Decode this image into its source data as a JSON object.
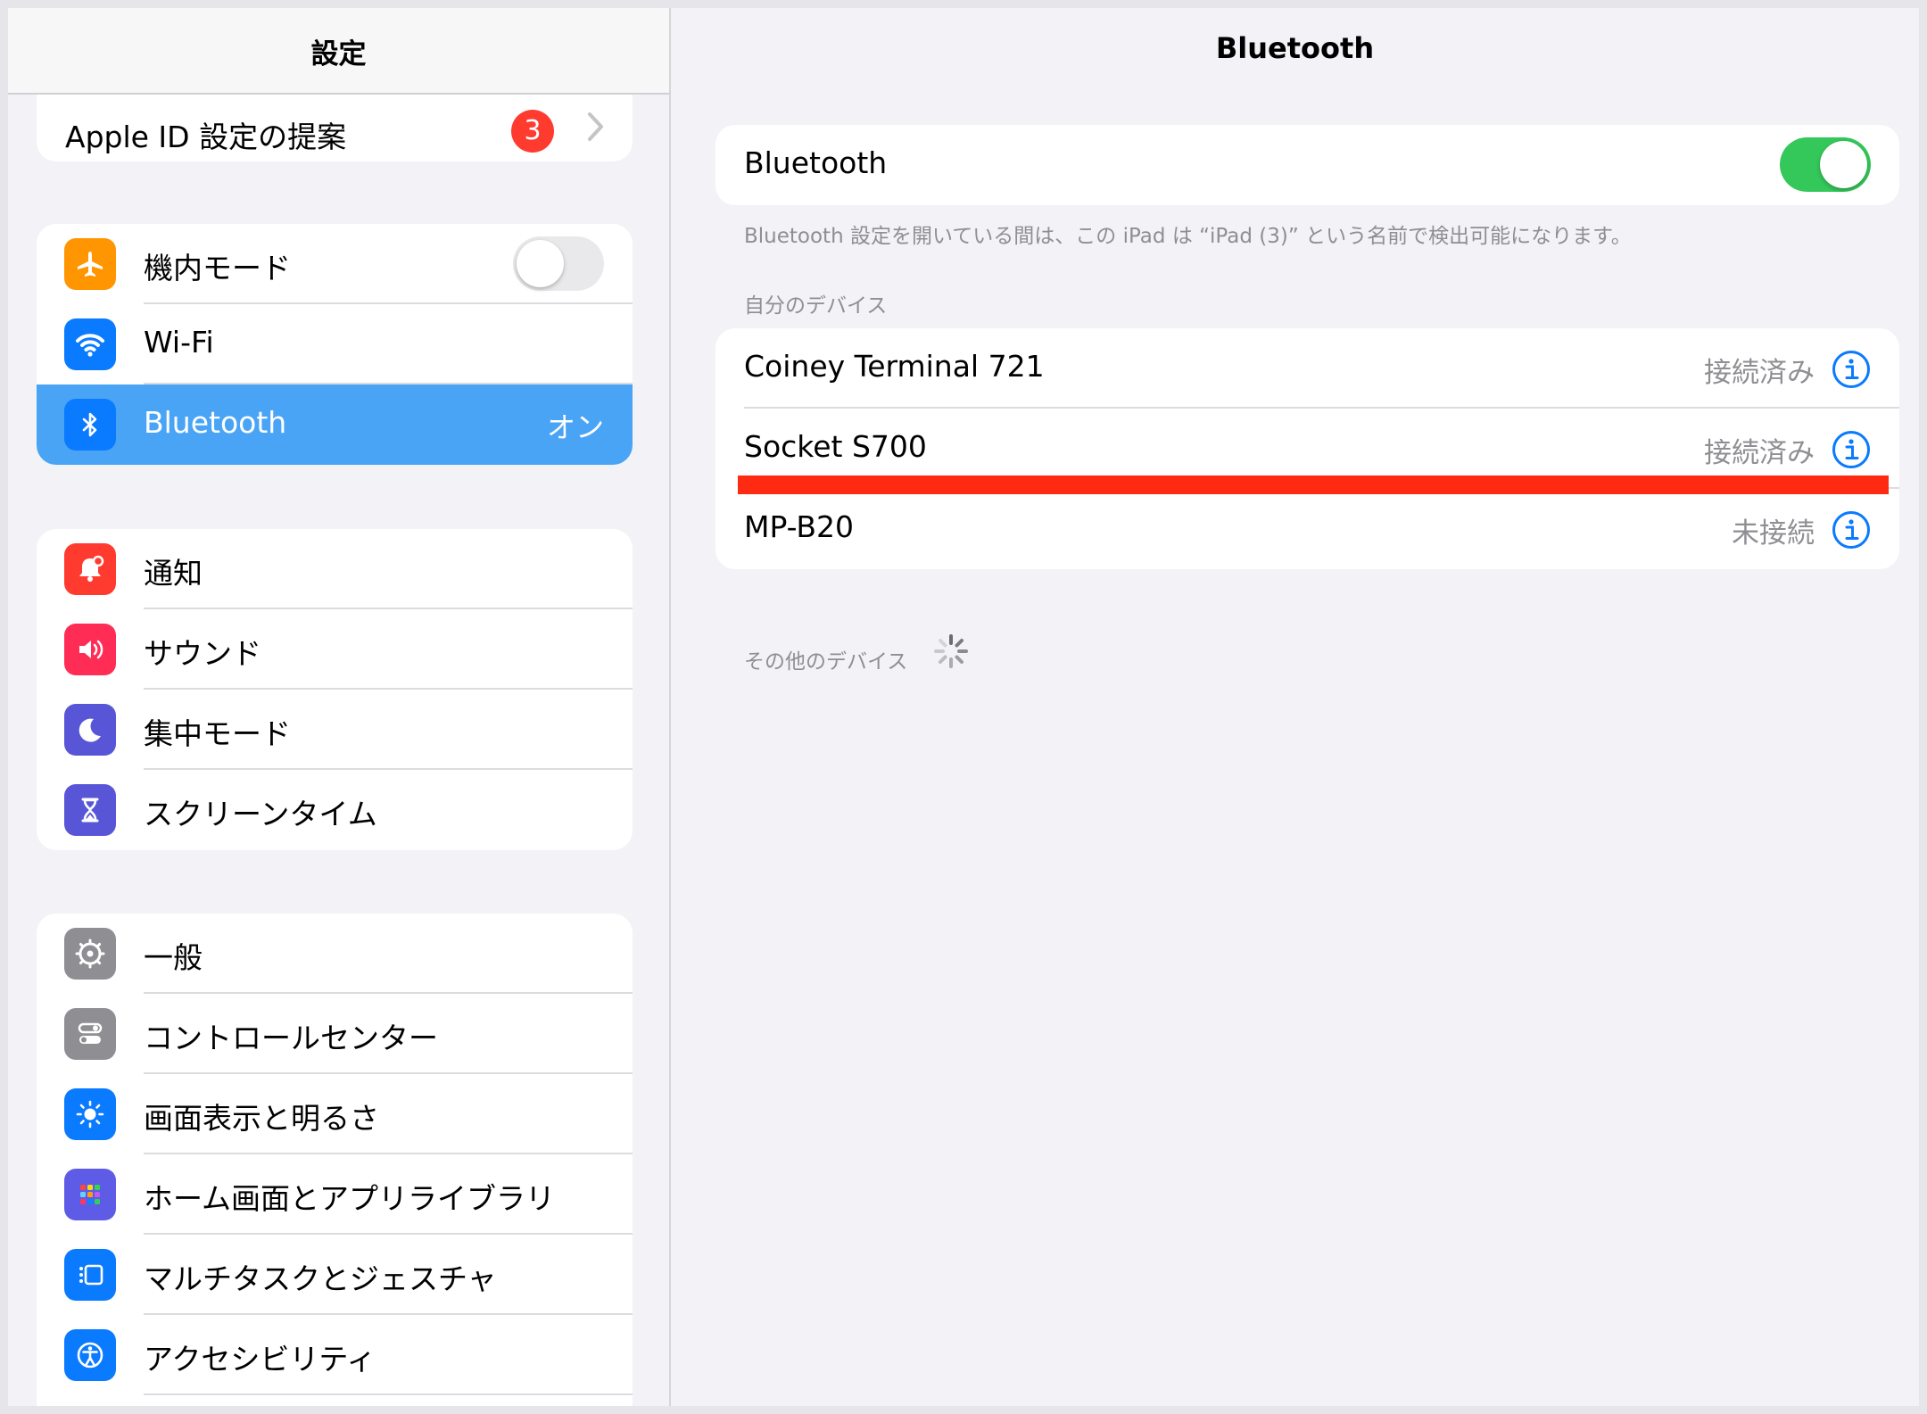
{
  "sidebar": {
    "title": "設定",
    "apple_id": {
      "label": "Apple ID 設定の提案",
      "badge": "3"
    },
    "connectivity": [
      {
        "label": "機内モード",
        "icon": "airplane-icon",
        "toggle": "off"
      },
      {
        "label": "Wi-Fi",
        "icon": "wifi-icon"
      },
      {
        "label": "Bluetooth",
        "icon": "bluetooth-icon",
        "value": "オン",
        "selected": true
      }
    ],
    "notifications": [
      {
        "label": "通知",
        "icon": "bell-icon"
      },
      {
        "label": "サウンド",
        "icon": "speaker-icon"
      },
      {
        "label": "集中モード",
        "icon": "moon-icon"
      },
      {
        "label": "スクリーンタイム",
        "icon": "hourglass-icon"
      }
    ],
    "general": [
      {
        "label": "一般",
        "icon": "gear-icon"
      },
      {
        "label": "コントロールセンター",
        "icon": "switches-icon"
      },
      {
        "label": "画面表示と明るさ",
        "icon": "sun-icon"
      },
      {
        "label": "ホーム画面とアプリライブラリ",
        "icon": "app-grid-icon"
      },
      {
        "label": "マルチタスクとジェスチャ",
        "icon": "multitask-icon"
      },
      {
        "label": "アクセシビリティ",
        "icon": "accessibility-icon"
      }
    ]
  },
  "detail": {
    "title": "Bluetooth",
    "bluetooth_toggle": {
      "label": "Bluetooth",
      "state": "on"
    },
    "note": "Bluetooth 設定を開いている間は、この iPad は “iPad (3)” という名前で検出可能になります。",
    "my_devices_header": "自分のデバイス",
    "my_devices": [
      {
        "name": "Coiney Terminal 721",
        "status": "接続済み"
      },
      {
        "name": "Socket S700",
        "status": "接続済み"
      },
      {
        "name": "MP-B20",
        "status": "未接続"
      }
    ],
    "other_devices_header": "その他のデバイス"
  },
  "colors": {
    "accent_blue": "#0a7aff",
    "selected_row": "#4aa4f5",
    "switch_on": "#34c759",
    "badge_red": "#ff3b30",
    "highlight_bar": "#ff2a12"
  }
}
